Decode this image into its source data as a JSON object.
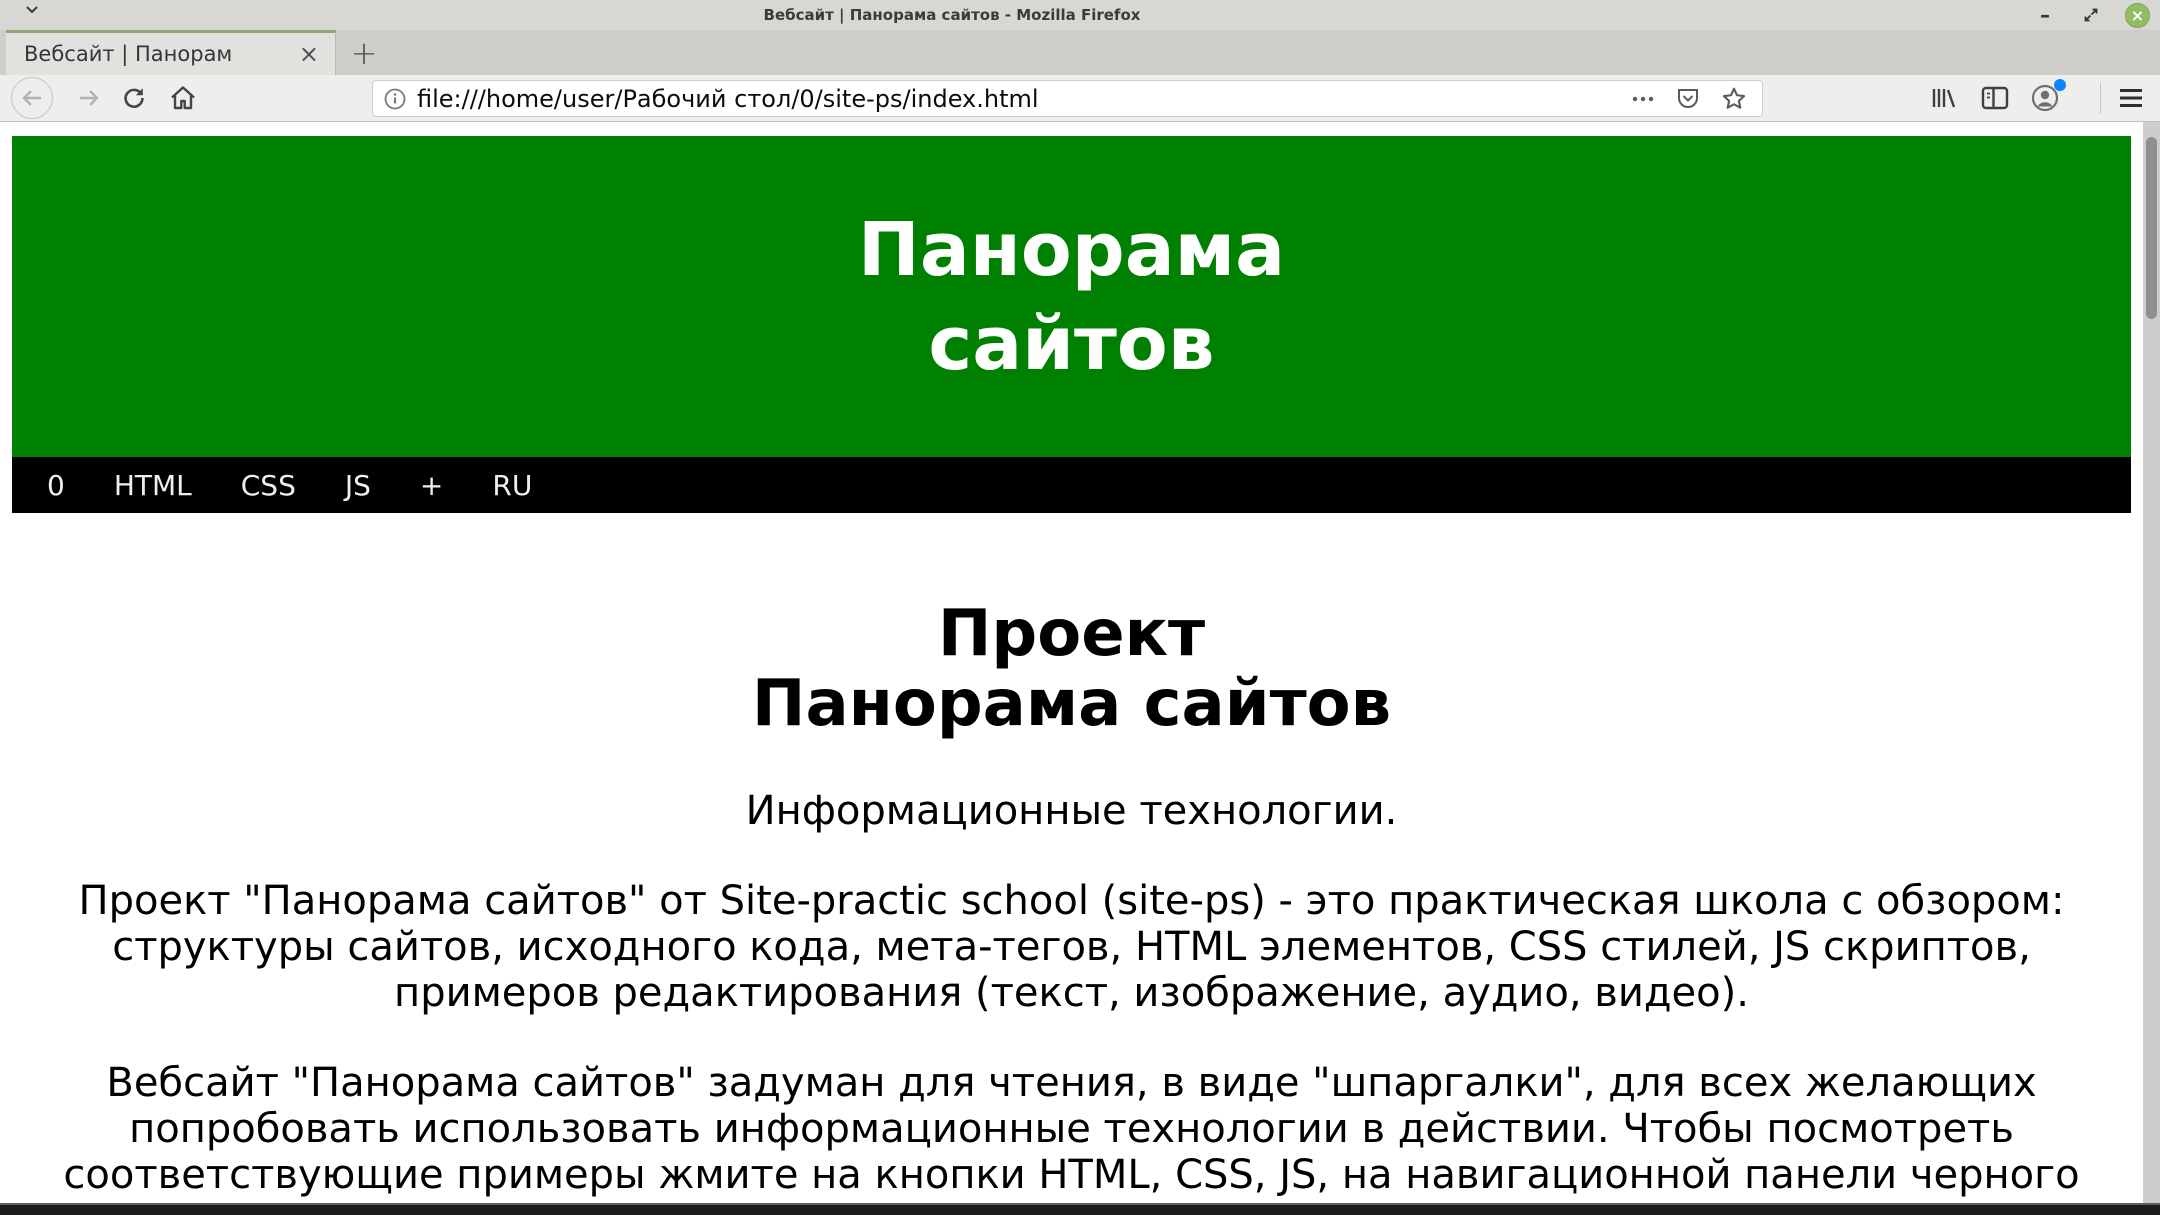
{
  "colors": {
    "titlebar": "#d8d7d4",
    "tab-green": "#8fa870",
    "toolbar": "#efeeec",
    "header-green": "#008000",
    "nav-black": "#000000",
    "close-green": "#93bd64"
  },
  "window": {
    "title": "Вебсайт | Панорама сайтов - Mozilla Firefox",
    "minimize_glyph": "–",
    "close_glyph": "×"
  },
  "tabbar": {
    "tab_title": "Вебсайт | Панорам",
    "tab_close_glyph": "×",
    "new_tab_glyph": "+"
  },
  "toolbar": {
    "url": "file:///home/user/Рабочий стол/0/site-ps/index.html"
  },
  "icons": {
    "shade-chevron": "chevron-down",
    "minimize": "minus",
    "maximize": "diagonal-arrows",
    "close": "x-in-green-circle",
    "back": "left-arrow-in-circle",
    "forward": "right-arrow",
    "reload": "circular-arrow",
    "home": "house",
    "page-info": "i-in-circle",
    "page-actions": "three-dots",
    "pocket": "badge-with-chevron",
    "bookmark": "star-outline",
    "library": "book-spines",
    "sidebar": "split-rectangle",
    "account": "person-in-circle-with-blue-dot",
    "menu": "hamburger"
  },
  "page": {
    "header_lines": [
      "Панорама",
      "сайтов"
    ],
    "nav": {
      "items": [
        "0",
        "HTML",
        "CSS",
        "JS",
        "+",
        "RU"
      ]
    },
    "heading_lines": [
      "Проект",
      "Панорама сайтов"
    ],
    "subtitle": "Информационные технологии.",
    "paragraph1_lines": [
      "Проект \"Панорама сайтов\" от Site-practic school (site-ps) - это практическая школа с обзором:",
      "структуры сайтов, исходного кода, мета-тегов, HTML элементов, CSS стилей, JS скриптов,",
      "примеров редактирования (текст, изображение, аудио, видео)."
    ],
    "paragraph2_lines": [
      "Вебсайт \"Панорама сайтов\" задуман для чтения, в виде \"шпаргалки\", для всех желающих",
      "попробовать использовать информационные технологии в действии. Чтобы посмотреть",
      "соответствующие примеры жмите на кнопки HTML, CSS, JS, на навигационной панели черного"
    ]
  }
}
